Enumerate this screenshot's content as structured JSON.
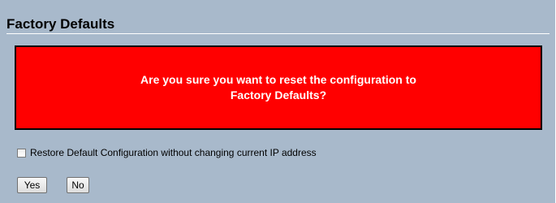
{
  "page": {
    "title": "Factory Defaults"
  },
  "warning": {
    "line1": "Are you sure you want to reset the configuration to",
    "line2": "Factory Defaults?"
  },
  "option": {
    "label": "Restore Default Configuration without changing current IP address",
    "checked": false
  },
  "actions": {
    "yes_label": "Yes",
    "no_label": "No"
  },
  "colors": {
    "panel_background": "#a8b9cb",
    "warning_background": "#ff0000",
    "warning_text": "#ffffff"
  }
}
